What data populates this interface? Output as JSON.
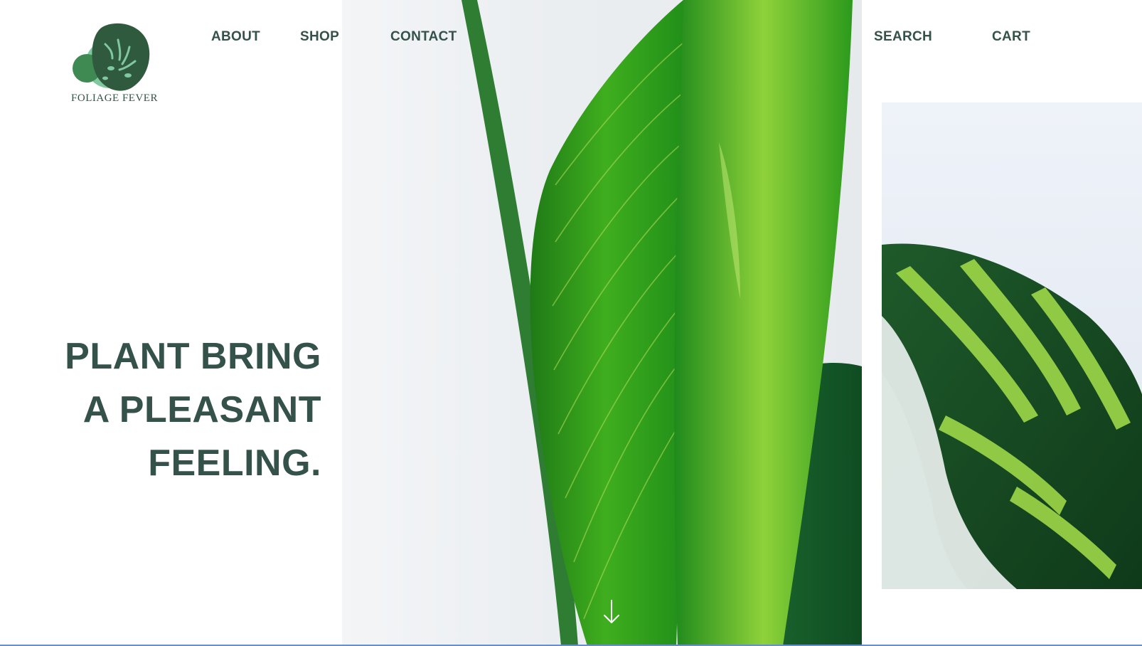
{
  "brand": {
    "name": "FOLIAGE FEVER",
    "logo_icon": "monstera-leaf-icon",
    "colors": {
      "primary": "#35524a",
      "logo_leaf": "#2f5a3d",
      "logo_mint": "#7fc8a0",
      "logo_forest": "#3e8a52"
    }
  },
  "nav": {
    "about": "ABOUT",
    "shop": "SHOP",
    "contact": "CONTACT",
    "search": "SEARCH",
    "cart": "CART"
  },
  "hero": {
    "headline_lines": [
      "PLANT BRING",
      "A PLEASANT",
      "FEELING."
    ],
    "scroll_icon": "arrow-down-icon",
    "photo_icon": "green-leaf-photo",
    "side_photo_icon": "calathea-leaf-photo"
  }
}
